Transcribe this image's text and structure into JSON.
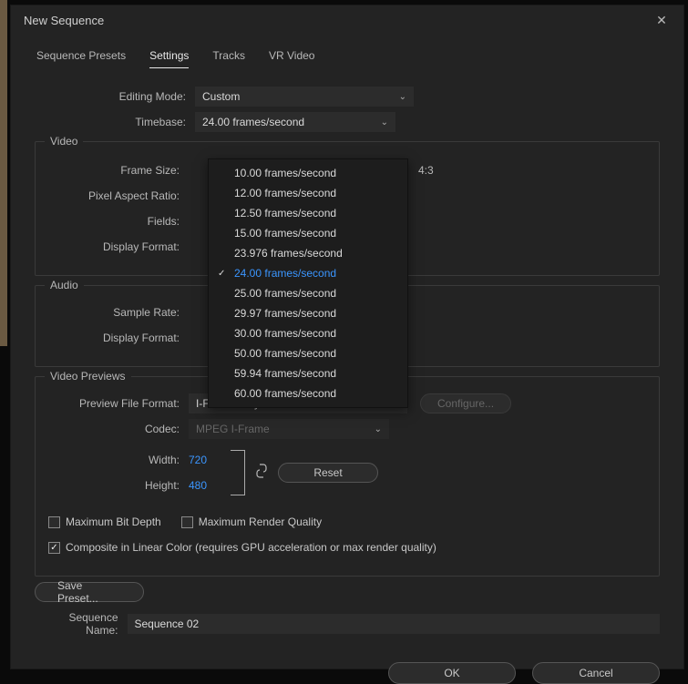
{
  "window_title": "New Sequence",
  "tabs": {
    "presets": "Sequence Presets",
    "settings": "Settings",
    "tracks": "Tracks",
    "vr": "VR Video"
  },
  "editing_mode": {
    "label": "Editing Mode:",
    "value": "Custom"
  },
  "timebase": {
    "label": "Timebase:",
    "value": "24.00  frames/second",
    "options": [
      "10.00  frames/second",
      "12.00  frames/second",
      "12.50  frames/second",
      "15.00  frames/second",
      "23.976  frames/second",
      "24.00  frames/second",
      "25.00  frames/second",
      "29.97  frames/second",
      "30.00  frames/second",
      "50.00  frames/second",
      "59.94  frames/second",
      "60.00  frames/second"
    ],
    "selected_index": 5
  },
  "video": {
    "legend": "Video",
    "frame_size_label": "Frame Size:",
    "ratio": "4:3",
    "par_label": "Pixel Aspect Ratio:",
    "fields_label": "Fields:",
    "display_format_label": "Display Format:"
  },
  "audio": {
    "legend": "Audio",
    "sample_rate_label": "Sample Rate:",
    "display_format_label": "Display Format:"
  },
  "previews": {
    "legend": "Video Previews",
    "pff_label": "Preview File Format:",
    "pff_value": "I-Frame Only MPEG",
    "codec_label": "Codec:",
    "codec_value": "MPEG I-Frame",
    "width_label": "Width:",
    "width_value": "720",
    "height_label": "Height:",
    "height_value": "480",
    "configure": "Configure...",
    "reset": "Reset",
    "max_bit_depth": "Maximum Bit Depth",
    "max_render_quality": "Maximum Render Quality",
    "composite": "Composite in Linear Color (requires GPU acceleration or max render quality)"
  },
  "save_preset": "Save Preset...",
  "sequence_name_label": "Sequence Name:",
  "sequence_name_value": "Sequence 02",
  "ok": "OK",
  "cancel": "Cancel"
}
